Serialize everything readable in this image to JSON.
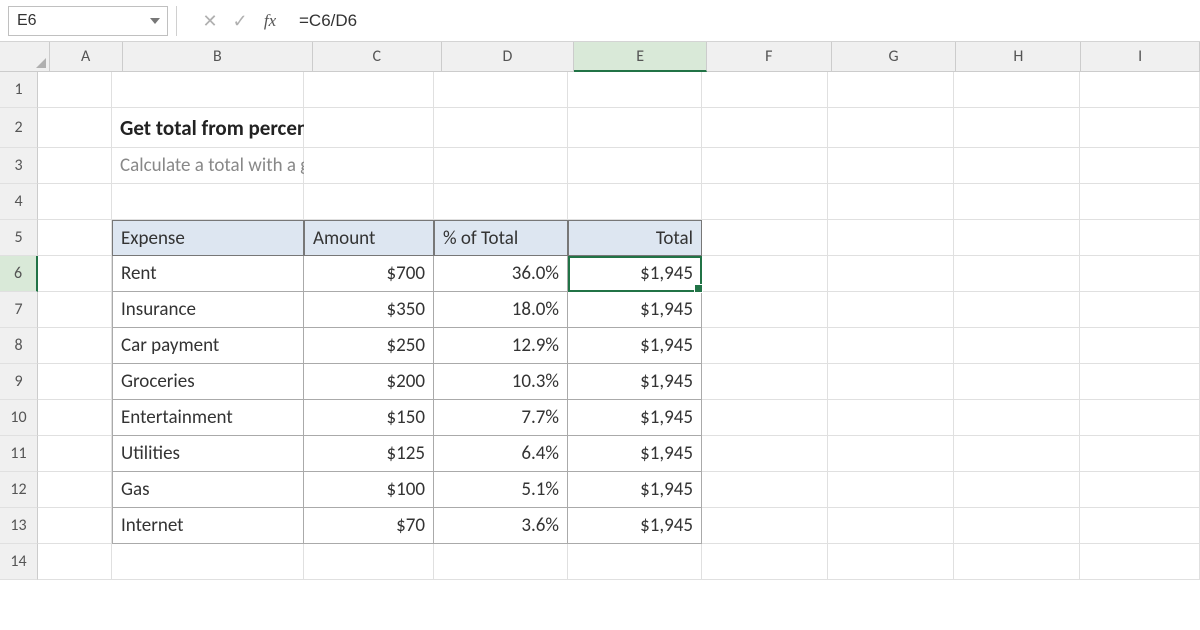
{
  "formula_bar": {
    "name_box": "E6",
    "formula": "=C6/D6"
  },
  "columns": [
    "A",
    "B",
    "C",
    "D",
    "E",
    "F",
    "G",
    "H",
    "I"
  ],
  "rows": [
    "1",
    "2",
    "3",
    "4",
    "5",
    "6",
    "7",
    "8",
    "9",
    "10",
    "11",
    "12",
    "13",
    "14"
  ],
  "selected_col": "E",
  "selected_row": "6",
  "content": {
    "title": "Get total from percent",
    "subtitle": "Calculate a total with a given amount and percentage"
  },
  "table": {
    "headers": {
      "expense": "Expense",
      "amount": "Amount",
      "pct": "% of Total",
      "total": "Total"
    },
    "rows": [
      {
        "expense": "Rent",
        "amount": "$700",
        "pct": "36.0%",
        "total": "$1,945"
      },
      {
        "expense": "Insurance",
        "amount": "$350",
        "pct": "18.0%",
        "total": "$1,945"
      },
      {
        "expense": "Car payment",
        "amount": "$250",
        "pct": "12.9%",
        "total": "$1,945"
      },
      {
        "expense": "Groceries",
        "amount": "$200",
        "pct": "10.3%",
        "total": "$1,945"
      },
      {
        "expense": "Entertainment",
        "amount": "$150",
        "pct": "7.7%",
        "total": "$1,945"
      },
      {
        "expense": "Utilities",
        "amount": "$125",
        "pct": "6.4%",
        "total": "$1,945"
      },
      {
        "expense": "Gas",
        "amount": "$100",
        "pct": "5.1%",
        "total": "$1,945"
      },
      {
        "expense": "Internet",
        "amount": "$70",
        "pct": "3.6%",
        "total": "$1,945"
      }
    ]
  }
}
